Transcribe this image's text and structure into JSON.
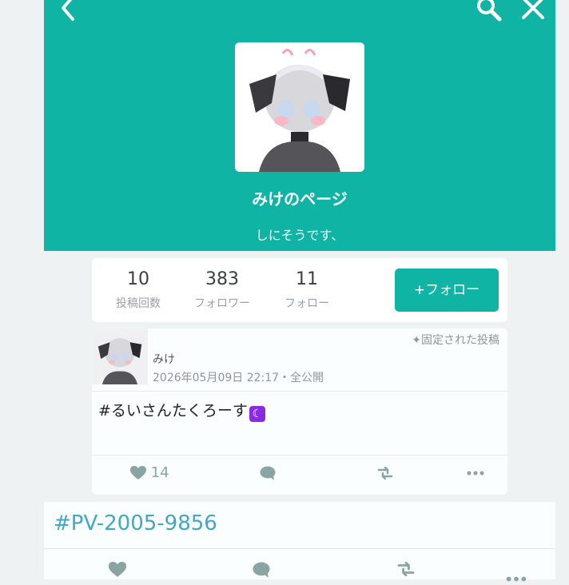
{
  "header": {
    "back_icon": "chevron-left-icon",
    "search_icon": "search-icon",
    "close_icon": "close-icon",
    "page_name": "みけのページ",
    "bio": "しにそうです、",
    "background_color": "#10b4a4"
  },
  "stats": {
    "posts": {
      "value": "10",
      "label": "投稿回数"
    },
    "followers": {
      "value": "383",
      "label": "フォロワー"
    },
    "following": {
      "value": "11",
      "label": "フォロー"
    },
    "follow_button_label": "+フォロー"
  },
  "post": {
    "pinned_label": "✦固定された投稿",
    "author": "みけ",
    "meta": "2026年05月09日 22:17・全公開",
    "text": "#るいさんたくろーす",
    "emoji_icon": "crescent-moon-icon",
    "like_count": "14",
    "actions": [
      "heart-icon",
      "comment-icon",
      "repost-icon",
      "more-icon"
    ]
  },
  "tag_bar": {
    "text": "#PV-2005-9856"
  },
  "bottom_bar": {
    "actions": [
      "heart-icon",
      "comment-icon",
      "repost-icon",
      "more-icon"
    ]
  }
}
